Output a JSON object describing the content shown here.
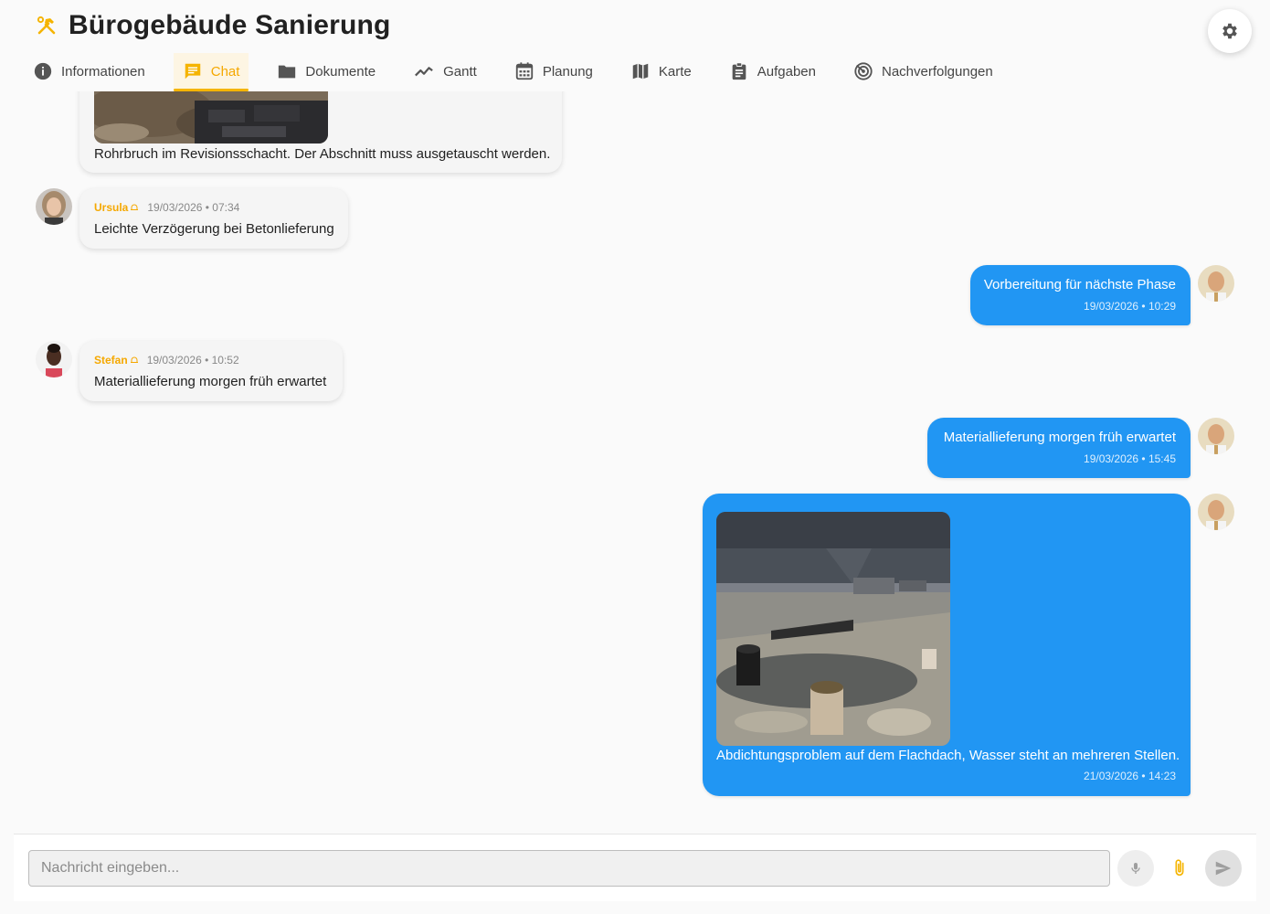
{
  "project": {
    "title": "Bürogebäude Sanierung",
    "icon": "hammer-wrench-icon"
  },
  "tabs": [
    {
      "label": "Informationen",
      "icon": "info-icon"
    },
    {
      "label": "Chat",
      "icon": "chat-icon",
      "active": true
    },
    {
      "label": "Dokumente",
      "icon": "folder-icon"
    },
    {
      "label": "Gantt",
      "icon": "trend-line-icon"
    },
    {
      "label": "Planung",
      "icon": "calendar-icon"
    },
    {
      "label": "Karte",
      "icon": "map-icon"
    },
    {
      "label": "Aufgaben",
      "icon": "clipboard-icon"
    },
    {
      "label": "Nachverfolgungen",
      "icon": "radar-icon"
    }
  ],
  "messages": [
    {
      "direction": "in",
      "text": "Rohrbruch im Revisionsschacht. Der Abschnitt muss ausgetauscht werden.",
      "has_image": true
    },
    {
      "direction": "in",
      "sender": "Ursula",
      "date": "19/03/2026 • 07:34",
      "text": "Leichte Verzögerung bei Betonlieferung"
    },
    {
      "direction": "out",
      "text": "Vorbereitung für nächste Phase",
      "date": "19/03/2026 • 10:29"
    },
    {
      "direction": "in",
      "sender": "Stefan",
      "date": "19/03/2026 • 10:52",
      "text": "Materiallieferung morgen früh erwartet"
    },
    {
      "direction": "out",
      "text": "Materiallieferung morgen früh erwartet",
      "date": "19/03/2026 • 15:45"
    },
    {
      "direction": "out",
      "text": "Abdichtungsproblem auf dem Flachdach, Wasser steht an mehreren Stellen.",
      "date": "21/03/2026 • 14:23",
      "has_image": true
    }
  ],
  "composer": {
    "placeholder": "Nachricht eingeben..."
  },
  "colors": {
    "accent": "#f5b400",
    "outgoing": "#2196f3",
    "incoming": "#f5f5f5"
  }
}
